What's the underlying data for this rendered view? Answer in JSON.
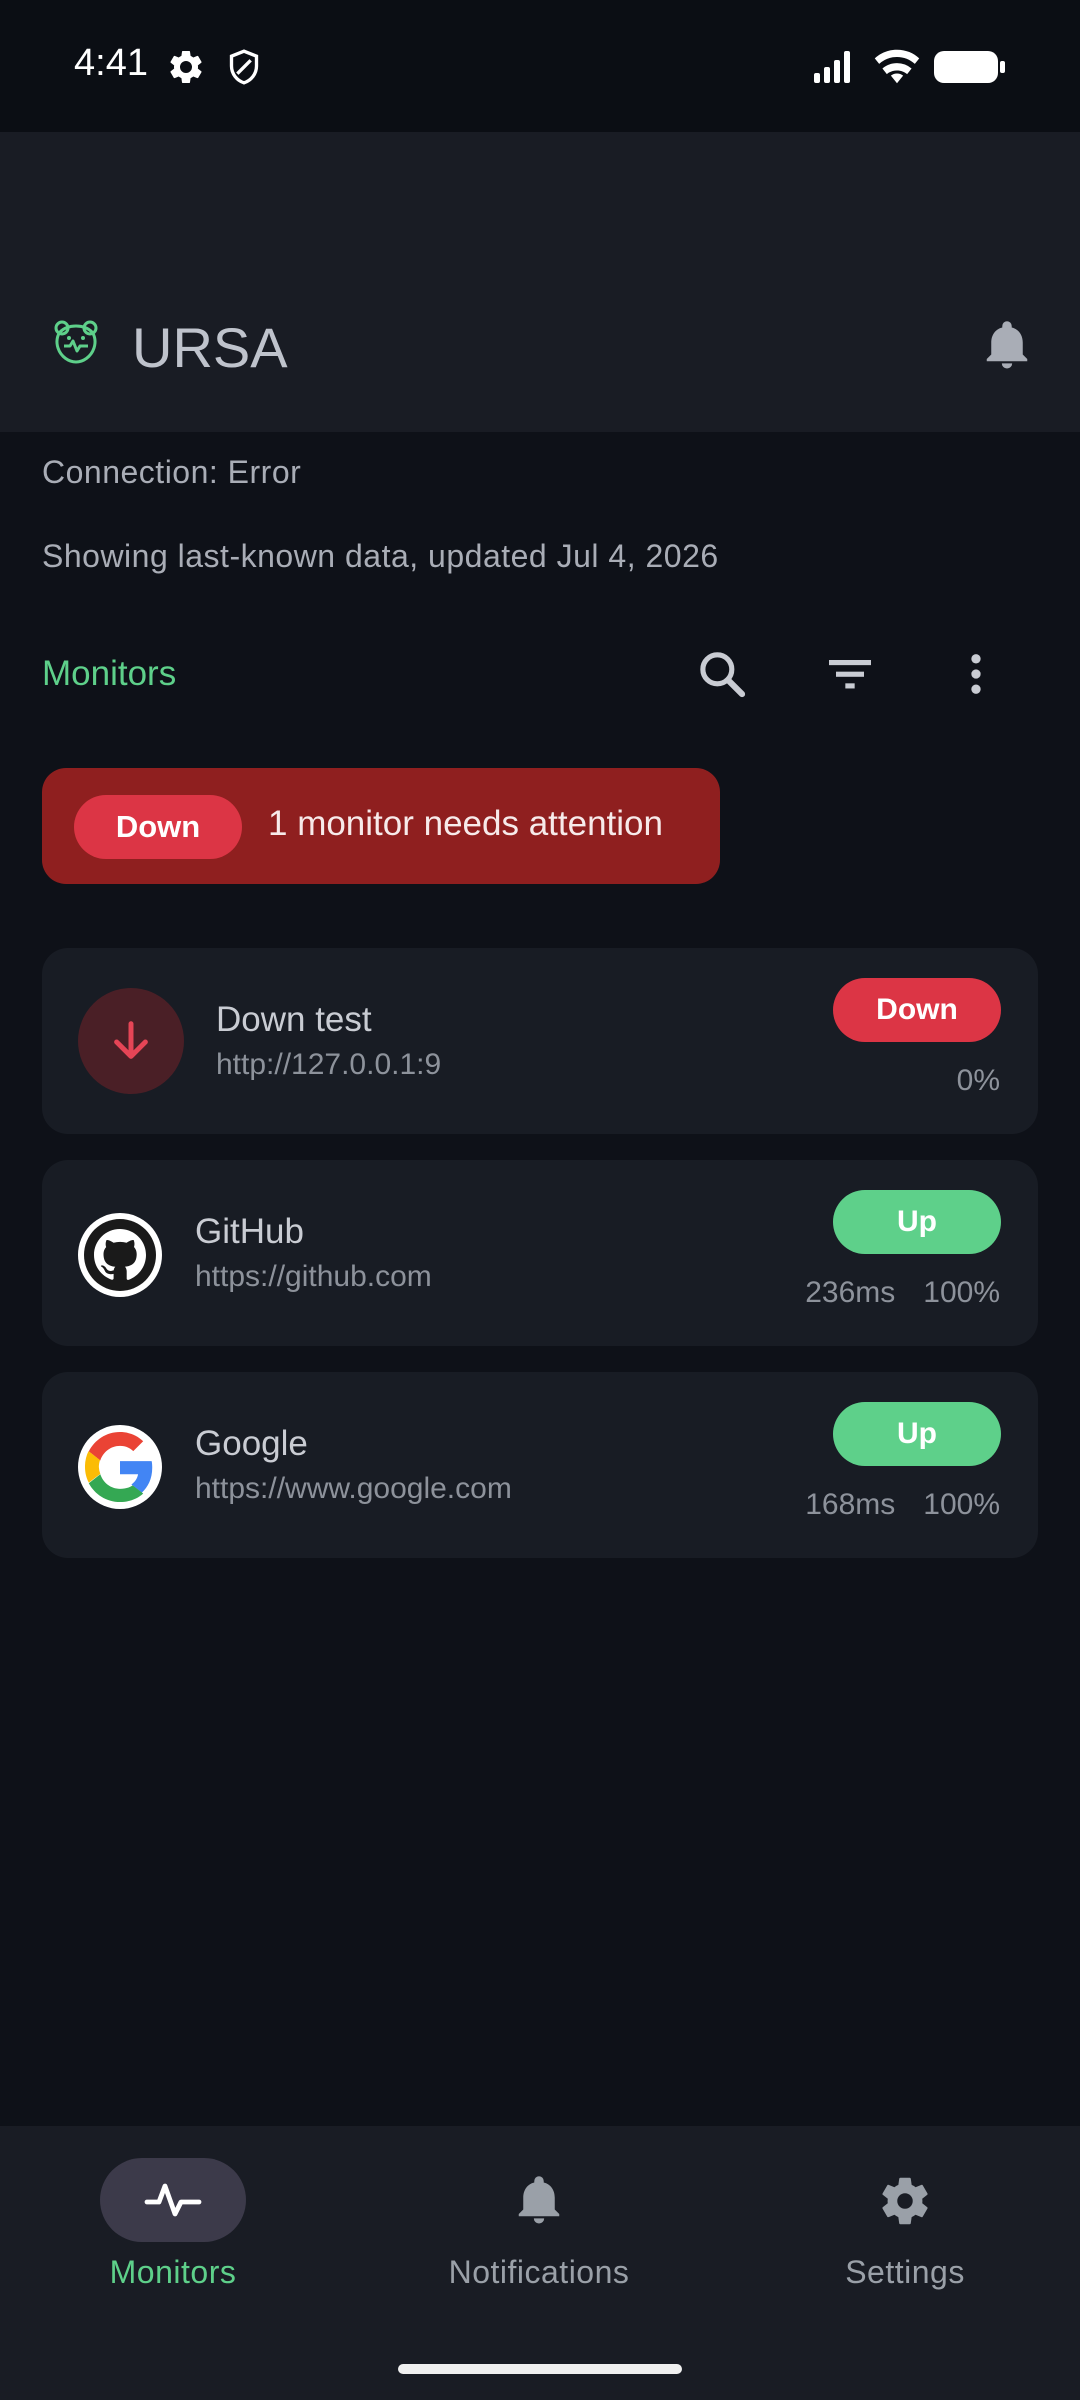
{
  "status_bar": {
    "time": "4:41",
    "icons": [
      "gear-icon",
      "shield-icon",
      "signal-icon",
      "wifi-icon",
      "battery-icon"
    ]
  },
  "app_bar": {
    "title": "URSA",
    "logo_icon": "bear-icon",
    "action_icon": "bell-icon"
  },
  "connection": {
    "status_text": "Connection: Error",
    "stale_text": "Showing last-known data, updated Jul 4, 2026"
  },
  "section": {
    "title": "Monitors",
    "tools": [
      "search-icon",
      "filter-icon",
      "more-vert-icon"
    ]
  },
  "alert": {
    "chip": "Down",
    "message": "1 monitor needs attention"
  },
  "monitors": [
    {
      "name": "Down test",
      "url": "http://127.0.0.1:9",
      "status": "Down",
      "response_time": "",
      "uptime": "0%",
      "icon": "arrow-down-icon"
    },
    {
      "name": "GitHub",
      "url": "https://github.com",
      "status": "Up",
      "response_time": "236ms",
      "uptime": "100%",
      "icon": "github-logo-icon"
    },
    {
      "name": "Google",
      "url": "https://www.google.com",
      "status": "Up",
      "response_time": "168ms",
      "uptime": "100%",
      "icon": "google-logo-icon"
    }
  ],
  "nav": {
    "items": [
      {
        "label": "Monitors",
        "icon": "pulse-icon",
        "active": true
      },
      {
        "label": "Notifications",
        "icon": "bell-icon",
        "active": false
      },
      {
        "label": "Settings",
        "icon": "gear-icon",
        "active": false
      }
    ]
  },
  "colors": {
    "background": "#0e1118",
    "surface": "#191c24",
    "card": "#181c24",
    "accent_green": "#5ed08a",
    "danger_red": "#dc3545",
    "alert_banner": "#8f1f1f"
  }
}
